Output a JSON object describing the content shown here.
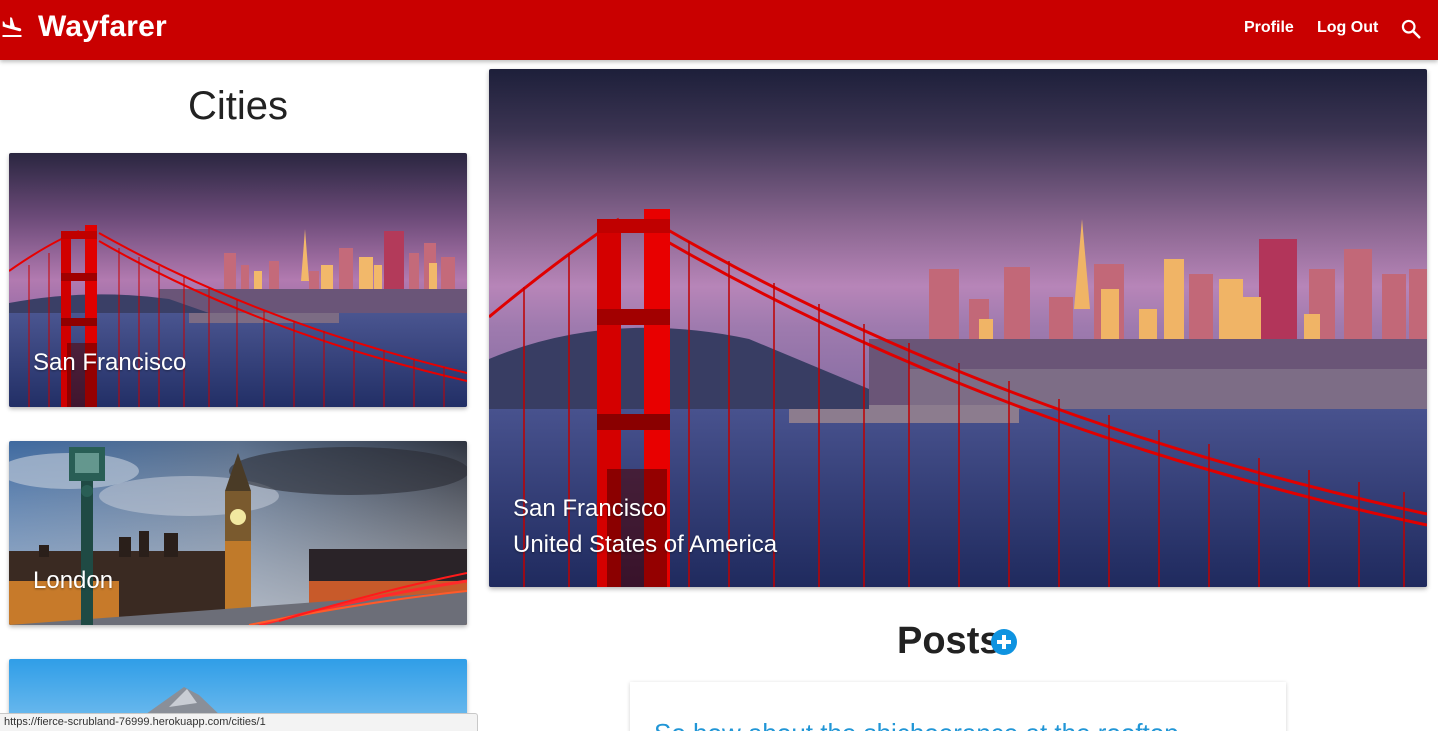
{
  "navbar": {
    "brand_icon": "airplane-landing-icon",
    "brand": "Wayfarer",
    "links": {
      "profile": "Profile",
      "logout": "Log Out"
    },
    "search_icon": "search-icon",
    "color": "#c90000"
  },
  "sidebar": {
    "heading": "Cities",
    "cities": [
      {
        "name": "San Francisco"
      },
      {
        "name": "London"
      },
      {
        "name": ""
      }
    ]
  },
  "main": {
    "city": "San Francisco",
    "country": "United States of America",
    "posts_heading": "Posts",
    "add_post_icon": "add-circle-icon",
    "posts": [
      {
        "title": "So how about the shichoerance at the rooftop"
      }
    ]
  },
  "status_bar": {
    "url": "https://fierce-scrubland-76999.herokuapp.com/cities/1"
  },
  "colors": {
    "accent": "#c90000",
    "link": "#2196d6",
    "add_button": "#0f93e0"
  }
}
